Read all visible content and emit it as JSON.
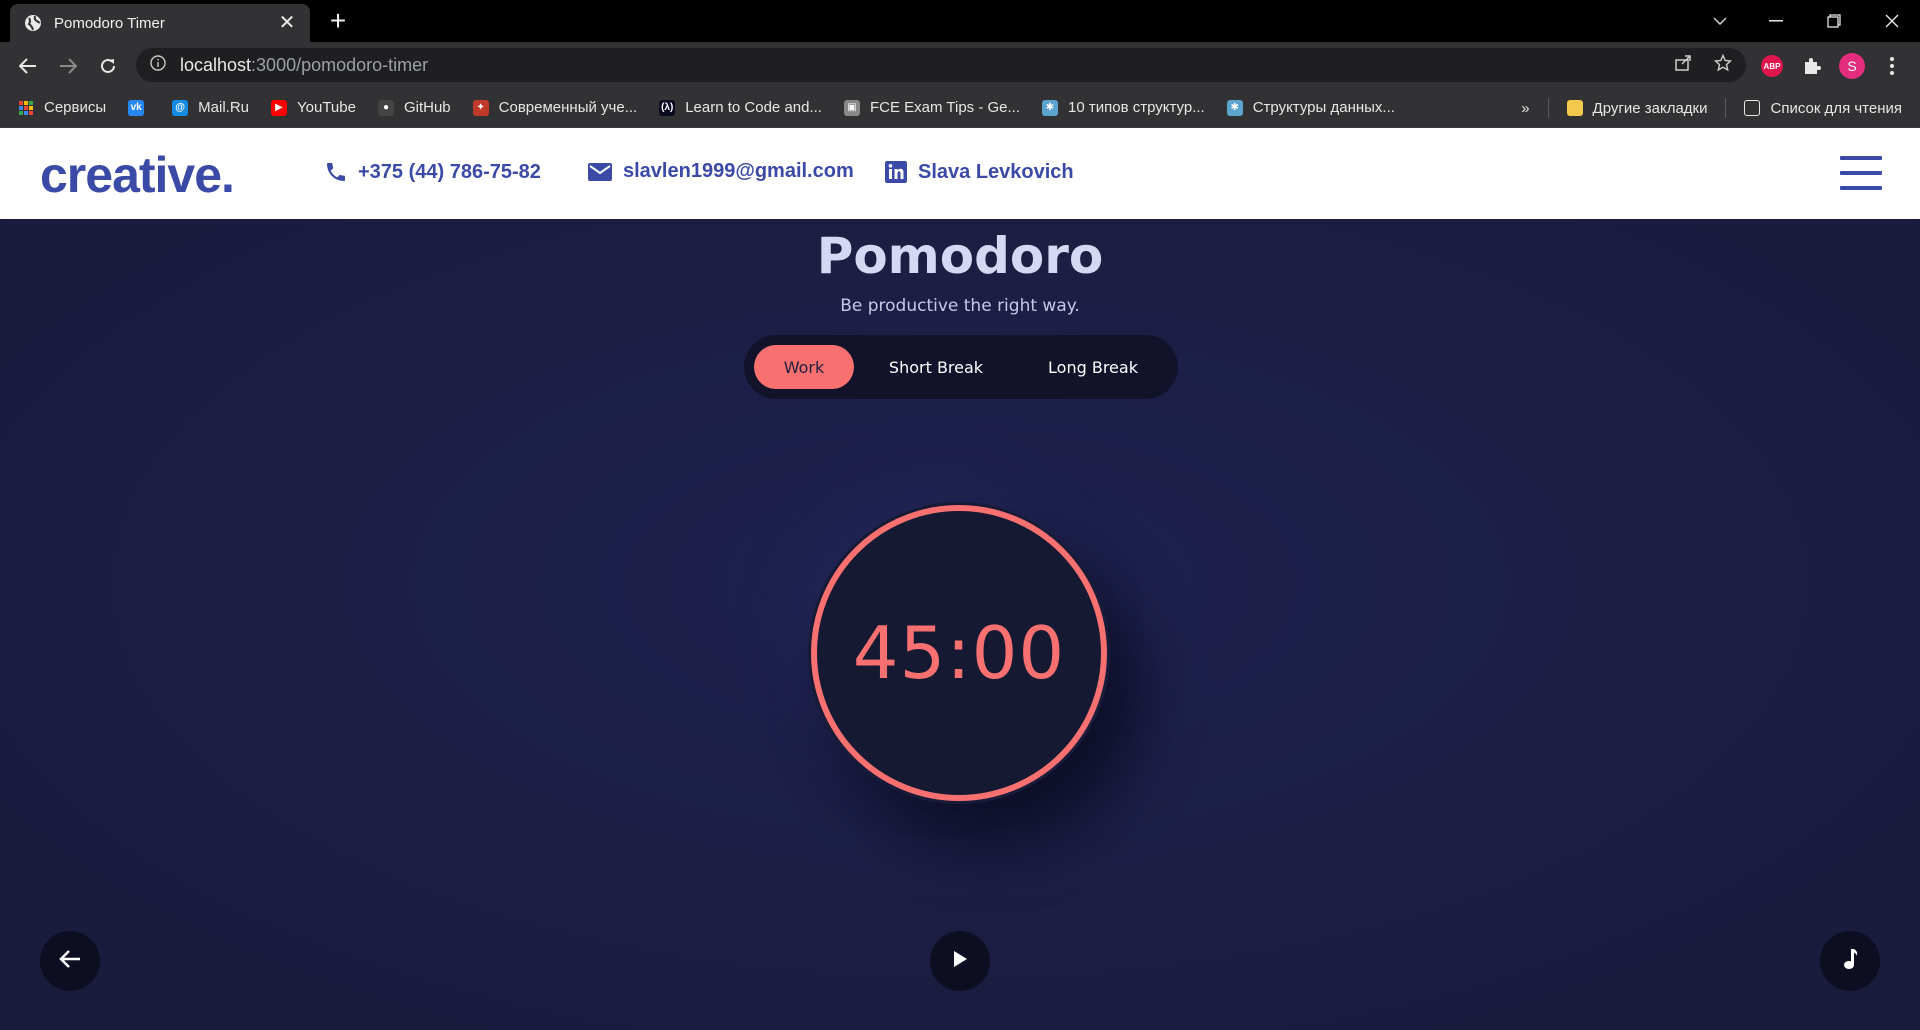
{
  "browser": {
    "tab_title": "Pomodoro Timer",
    "url_host": "localhost",
    "url_path": ":3000/pomodoro-timer",
    "profile_initial": "S",
    "abp_label": "ABP",
    "bookmarks": [
      {
        "label": "Сервисы",
        "icon": "apps-grid-icon",
        "color": "#4285f4"
      },
      {
        "label": "",
        "icon": "vk-icon",
        "color": "#2787f5",
        "glyph": "vk"
      },
      {
        "label": "Mail.Ru",
        "icon": "mailru-icon",
        "color": "#168de2",
        "glyph": "@"
      },
      {
        "label": "YouTube",
        "icon": "youtube-icon",
        "color": "#ff0000",
        "glyph": "▶"
      },
      {
        "label": "GitHub",
        "icon": "github-icon",
        "color": "#444444",
        "glyph": "●"
      },
      {
        "label": "Современный уче...",
        "icon": "js-tutorial-icon",
        "color": "#c0392b",
        "glyph": "✦"
      },
      {
        "label": "Learn to Code and...",
        "icon": "freecodecamp-icon",
        "color": "#0a0a23",
        "glyph": "(λ)"
      },
      {
        "label": "FCE Exam Tips - Ge...",
        "icon": "fce-icon",
        "color": "#888888",
        "glyph": "▣"
      },
      {
        "label": "10 типов структур...",
        "icon": "habr-icon",
        "color": "#5ba4cf",
        "glyph": "✱"
      },
      {
        "label": "Структуры данных...",
        "icon": "habr-icon-2",
        "color": "#5ba4cf",
        "glyph": "✱"
      }
    ],
    "more_bookmarks": "»",
    "other_bookmarks": "Другие закладки",
    "reading_list": "Список для чтения"
  },
  "header": {
    "logo": "creative.",
    "phone": "+375 (44) 786-75-82",
    "email": "slavlen1999@gmail.com",
    "linkedin": "Slava Levkovich"
  },
  "app": {
    "title": "Pomodoro",
    "subtitle": "Be productive the right way.",
    "modes": [
      "Work",
      "Short Break",
      "Long Break"
    ],
    "active_mode": "Work",
    "time": "45:00",
    "accent_color": "#f87070"
  }
}
